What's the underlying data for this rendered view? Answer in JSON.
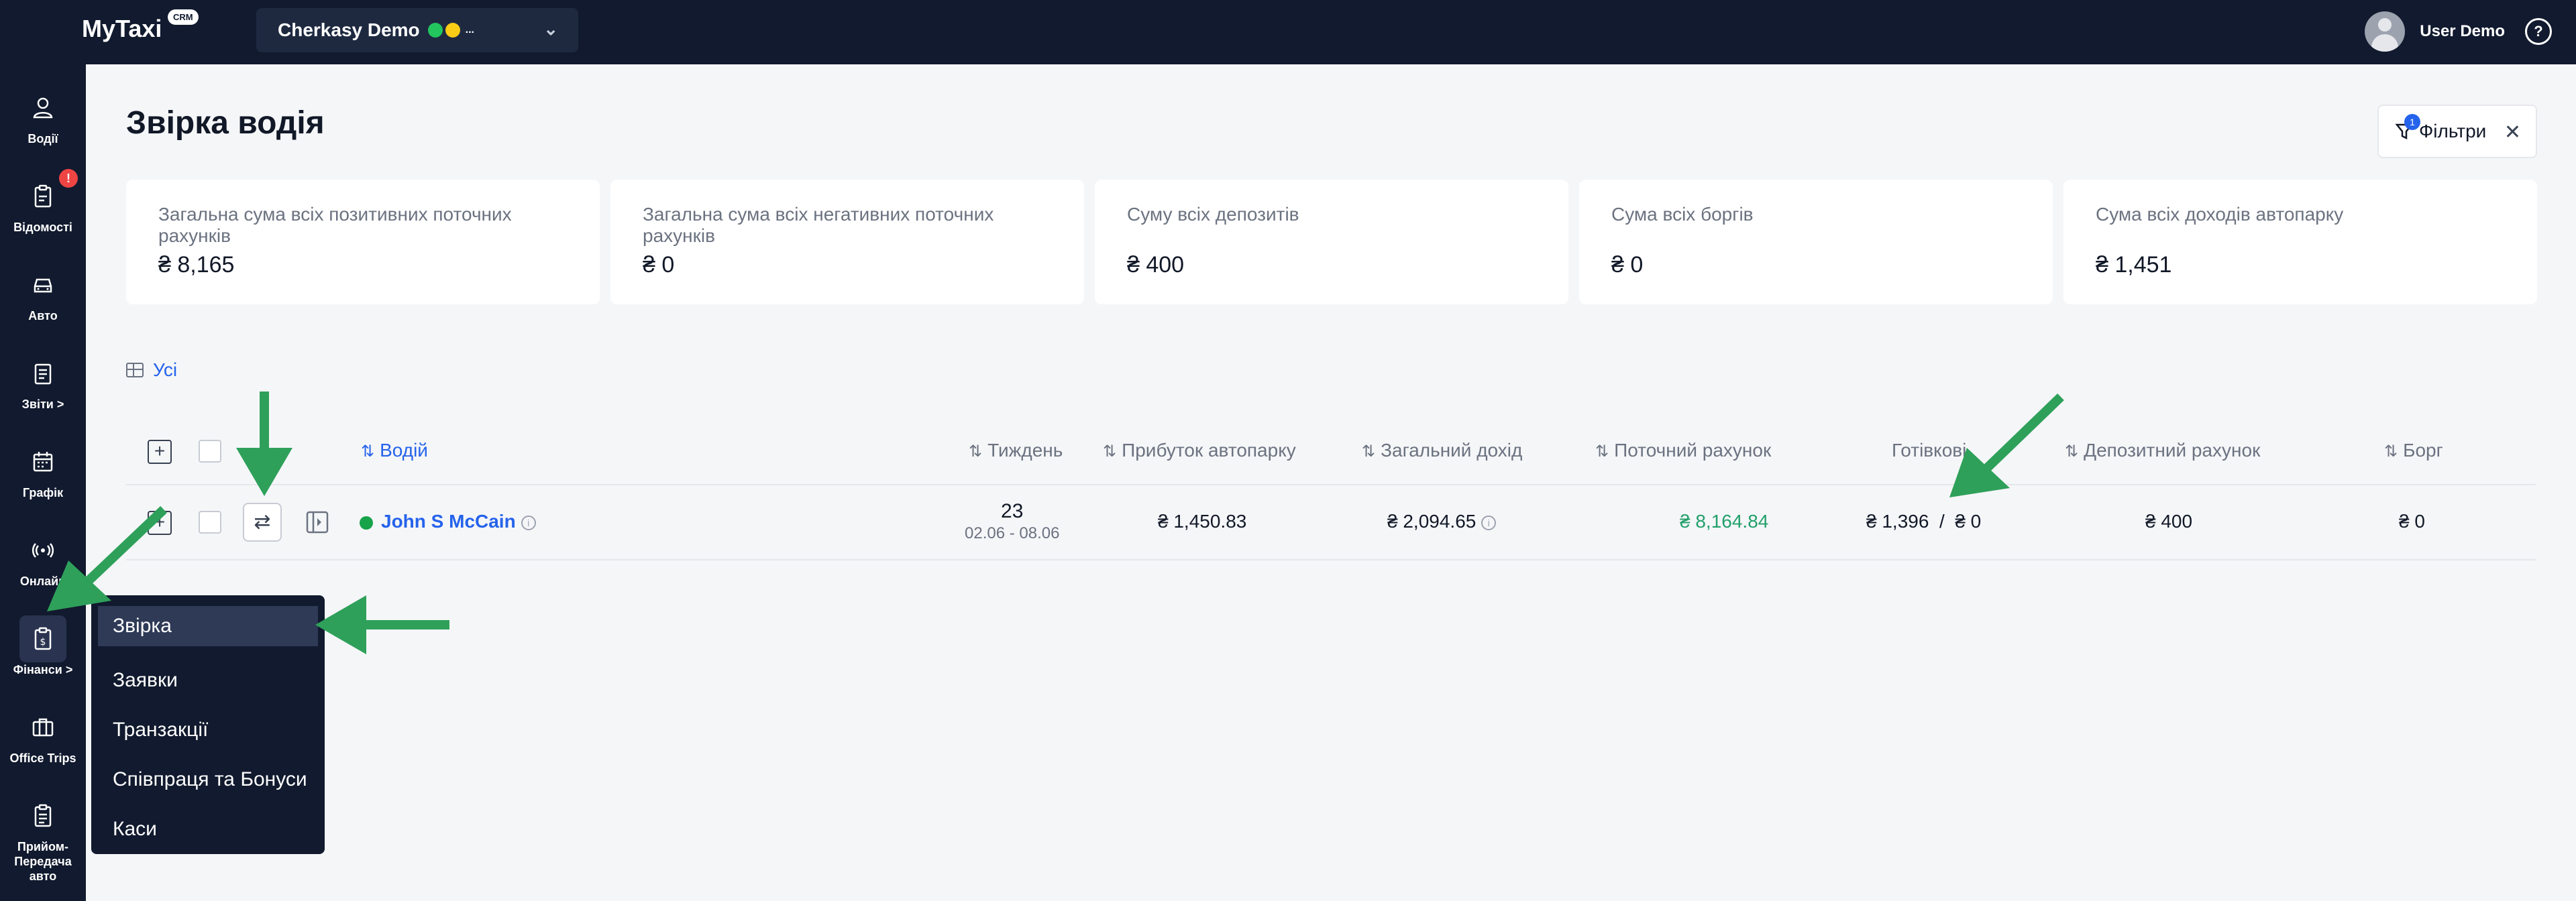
{
  "topbar": {
    "logo": "MyTaxi",
    "logo_badge": "CRM",
    "company": "Cherkasy Demo",
    "company_more": "...",
    "user_name": "User Demo",
    "help": "?"
  },
  "sidebar": {
    "items": [
      {
        "label": "Водії",
        "icon": "user-icon"
      },
      {
        "label": "Відомості",
        "icon": "clipboard-icon",
        "badge": "!"
      },
      {
        "label": "Авто",
        "icon": "car-icon"
      },
      {
        "label": "Звіти >",
        "icon": "report-icon"
      },
      {
        "label": "Графік",
        "icon": "calendar-icon"
      },
      {
        "label": "Онлайн",
        "icon": "broadcast-icon"
      },
      {
        "label": "Фінанси >",
        "icon": "finance-icon"
      },
      {
        "label": "Office Trips",
        "icon": "briefcase-icon"
      },
      {
        "label": "Прийом-Передача авто",
        "icon": "clipboard-list-icon"
      }
    ]
  },
  "page": {
    "title": "Звірка водія",
    "filter_label": "Фільтри",
    "filter_count": "1"
  },
  "summary": [
    {
      "label": "Загальна сума всіх позитивних поточних рахунків",
      "value": "₴ 8,165"
    },
    {
      "label": "Загальна сума всіх негативних поточних рахунків",
      "value": "₴ 0"
    },
    {
      "label": "Суму всіх депозитів",
      "value": "₴ 400"
    },
    {
      "label": "Сума всіх боргів",
      "value": "₴ 0"
    },
    {
      "label": "Сума всіх доходів автопарку",
      "value": "₴ 1,451"
    }
  ],
  "view": {
    "label": "Усі"
  },
  "table": {
    "columns": {
      "driver": "Водій",
      "week": "Тиждень",
      "fleet_profit": "Прибуток автопарку",
      "total_income": "Загальний дохід",
      "current_account": "Поточний рахунок",
      "cash": "Готівкові",
      "deposit": "Депозитний рахунок",
      "debt": "Борг"
    },
    "rows": [
      {
        "driver": "John S McCain",
        "week_num": "23",
        "week_range": "02.06 - 08.06",
        "fleet_profit": "₴ 1,450.83",
        "total_income": "₴ 2,094.65",
        "current_account": "₴ 8,164.84",
        "cash": "₴ 1,396  /  ₴ 0",
        "deposit": "₴ 400",
        "debt": "₴ 0"
      }
    ]
  },
  "finance_menu": {
    "items": [
      "Звірка",
      "Заявки",
      "Транзакції",
      "Співпраця та Бонуси",
      "Каси"
    ]
  },
  "colors": {
    "navy": "#111a2e",
    "accent": "#2563eb",
    "positive": "#22a06b",
    "arrow": "#2ea05a"
  }
}
